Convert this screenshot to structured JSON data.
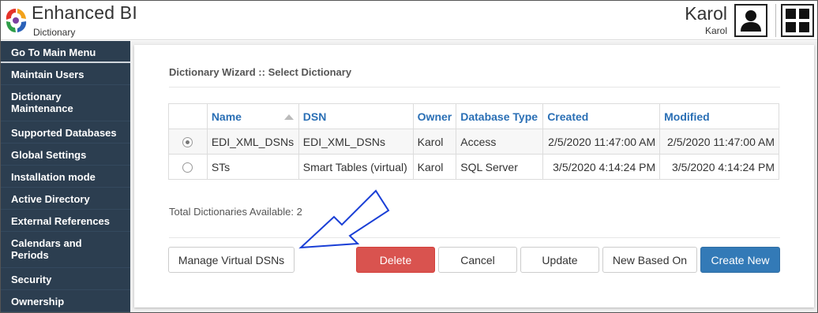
{
  "header": {
    "app_title": "Enhanced BI",
    "app_subtitle": "Dictionary",
    "user_name": "Karol",
    "user_sub": "Karol"
  },
  "sidebar": {
    "items": [
      {
        "label": "Go To Main Menu"
      },
      {
        "label": "Maintain Users"
      },
      {
        "label": "Dictionary Maintenance"
      },
      {
        "label": "Supported Databases"
      },
      {
        "label": "Global Settings"
      },
      {
        "label": "Installation mode"
      },
      {
        "label": "Active Directory"
      },
      {
        "label": "External References"
      },
      {
        "label": "Calendars and Periods"
      },
      {
        "label": "Security"
      },
      {
        "label": "Ownership"
      }
    ]
  },
  "main": {
    "title": "Dictionary Wizard :: Select Dictionary",
    "table": {
      "headers": [
        "",
        "Name",
        "DSN",
        "Owner",
        "Database Type",
        "Created",
        "Modified"
      ],
      "rows": [
        {
          "selected": true,
          "name": "EDI_XML_DSNs",
          "dsn": "EDI_XML_DSNs",
          "owner": "Karol",
          "db_type": "Access",
          "created": "2/5/2020 11:47:00 AM",
          "modified": "2/5/2020 11:47:00 AM"
        },
        {
          "selected": false,
          "name": "STs",
          "dsn": "Smart Tables (virtual)",
          "owner": "Karol",
          "db_type": "SQL Server",
          "created": "3/5/2020 4:14:24 PM",
          "modified": "3/5/2020 4:14:24 PM"
        }
      ]
    },
    "total_label": "Total Dictionaries Available: 2",
    "buttons": {
      "manage": "Manage Virtual DSNs",
      "delete": "Delete",
      "cancel": "Cancel",
      "update": "Update",
      "new_based_on": "New Based On",
      "create_new": "Create New"
    }
  },
  "colors": {
    "sidebar_bg": "#2c3e50",
    "link_blue": "#2a6fb5",
    "danger": "#d9534f",
    "primary": "#337ab7",
    "annotation_arrow": "#1a3fd6"
  }
}
